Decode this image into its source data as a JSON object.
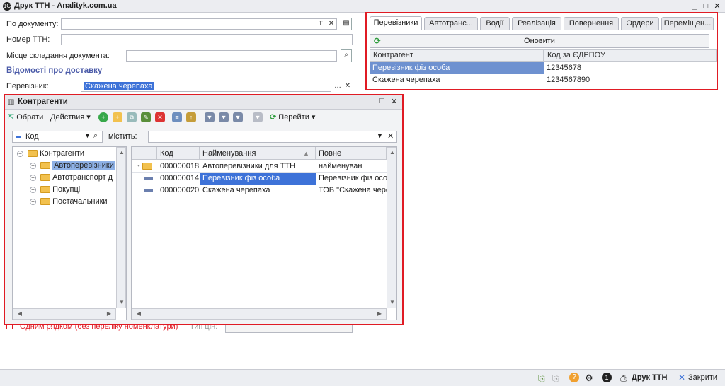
{
  "window": {
    "title": "Друк ТТН - Analityk.com.ua"
  },
  "form": {
    "doc_label": "По документу:",
    "ttn_label": "Номер ТТН:",
    "place_label": "Місце складання документа:",
    "delivery_section": "Відомості про доставку",
    "carrier_label": "Перевізник:",
    "carrier_value": "Скажена черепаха",
    "one_row_label": "Одним рядком (без переліку номенклатури)",
    "price_type_label": "Тип цін:"
  },
  "right_pane": {
    "tabs": [
      "Перевізники",
      "Автотранс...",
      "Водії",
      "Реалізація",
      "Повернення",
      "Ордери",
      "Переміщен..."
    ],
    "refresh_label": "Оновити",
    "columns": [
      "Контрагент",
      "Код за ЄДРПОУ"
    ],
    "rows": [
      {
        "name": "Перевізник фіз особа",
        "code": "12345678"
      },
      {
        "name": "Скажена черепаха",
        "code": "1234567890"
      }
    ]
  },
  "dialog": {
    "title": "Контрагенти",
    "toolbar": {
      "select": "Обрати",
      "actions": "Действия",
      "goto": "Перейти"
    },
    "filter": {
      "field": "Код",
      "contains": "містить:"
    },
    "tree": {
      "root": "Контрагенти",
      "items": [
        "Автоперевізники",
        "Автотранспорт д",
        "Покупці",
        "Постачальники"
      ]
    },
    "list": {
      "columns": [
        "Код",
        "Найменування",
        "Повне найменуван"
      ],
      "rows": [
        {
          "code": "000000018",
          "name": "Автоперевізники для ТТН",
          "full": ""
        },
        {
          "code": "000000014",
          "name": "Перевізник фіз особа",
          "full": "Перевізник фіз осо"
        },
        {
          "code": "000000020",
          "name": "Скажена черепаха",
          "full": "ТОВ \"Скажена чере"
        }
      ]
    }
  },
  "statusbar": {
    "print": "Друк ТТН",
    "close": "Закрити"
  },
  "colors": {
    "accent_red": "#e01b24",
    "selection": "#3d72d8",
    "section": "#4a5aa8"
  }
}
